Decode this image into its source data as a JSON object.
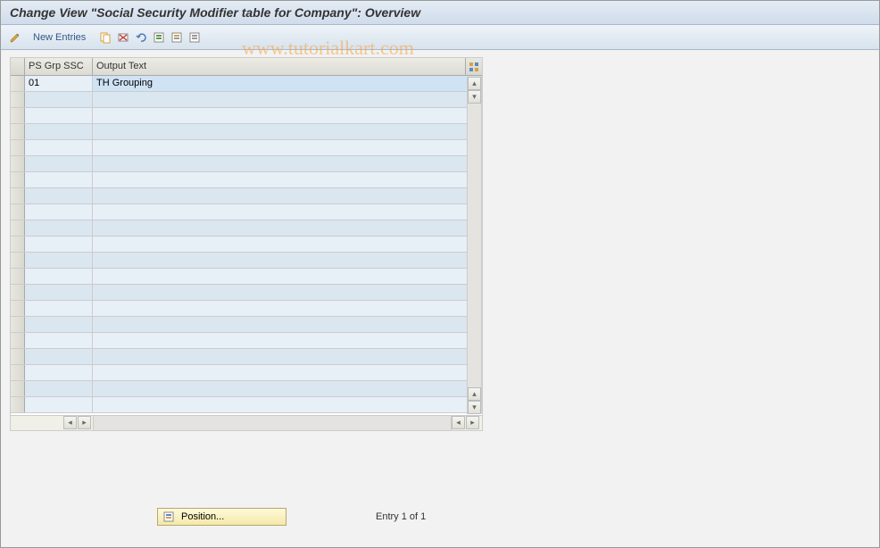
{
  "header": {
    "title": "Change View \"Social Security Modifier table for Company\": Overview"
  },
  "toolbar": {
    "new_entries_label": "New Entries"
  },
  "watermark": "www.tutorialkart.com",
  "grid": {
    "columns": {
      "col1": "PS Grp SSC",
      "col2": "Output Text"
    },
    "rows": [
      {
        "ps_grp_ssc": "01",
        "output_text": "TH Grouping"
      },
      {
        "ps_grp_ssc": "",
        "output_text": ""
      },
      {
        "ps_grp_ssc": "",
        "output_text": ""
      },
      {
        "ps_grp_ssc": "",
        "output_text": ""
      },
      {
        "ps_grp_ssc": "",
        "output_text": ""
      },
      {
        "ps_grp_ssc": "",
        "output_text": ""
      },
      {
        "ps_grp_ssc": "",
        "output_text": ""
      },
      {
        "ps_grp_ssc": "",
        "output_text": ""
      },
      {
        "ps_grp_ssc": "",
        "output_text": ""
      },
      {
        "ps_grp_ssc": "",
        "output_text": ""
      },
      {
        "ps_grp_ssc": "",
        "output_text": ""
      },
      {
        "ps_grp_ssc": "",
        "output_text": ""
      },
      {
        "ps_grp_ssc": "",
        "output_text": ""
      },
      {
        "ps_grp_ssc": "",
        "output_text": ""
      },
      {
        "ps_grp_ssc": "",
        "output_text": ""
      },
      {
        "ps_grp_ssc": "",
        "output_text": ""
      },
      {
        "ps_grp_ssc": "",
        "output_text": ""
      },
      {
        "ps_grp_ssc": "",
        "output_text": ""
      },
      {
        "ps_grp_ssc": "",
        "output_text": ""
      },
      {
        "ps_grp_ssc": "",
        "output_text": ""
      },
      {
        "ps_grp_ssc": "",
        "output_text": ""
      }
    ]
  },
  "footer": {
    "position_label": "Position...",
    "entry_text": "Entry 1 of 1"
  }
}
